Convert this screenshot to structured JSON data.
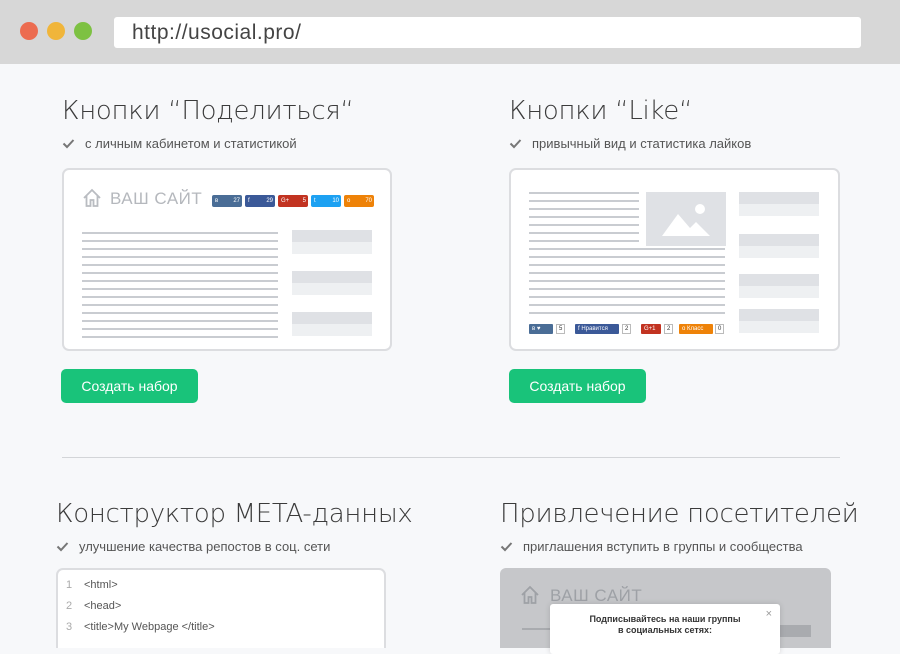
{
  "browser": {
    "url": "http://usocial.pro/"
  },
  "sections": {
    "share": {
      "title": "Кнопки “Поделиться“",
      "subtitle": "с личным кабинетом и статистикой",
      "button": "Создать набор",
      "site_label": "ВАШ САЙТ",
      "counts": [
        "27",
        "29",
        "5",
        "10",
        "70"
      ],
      "network_icons": [
        "vk-icon",
        "facebook-icon",
        "google-plus-icon",
        "twitter-icon",
        "odnoklassniki-icon"
      ],
      "network_colors": [
        "#4a6d96",
        "#3b5998",
        "#c23321",
        "#1da1f2",
        "#ee8208"
      ]
    },
    "like": {
      "title": "Кнопки “Like“",
      "subtitle": "привычный вид и статистика лайков",
      "button": "Создать набор",
      "like_labels": [
        "Нравится",
        "Класс"
      ],
      "like_counts": [
        "5",
        "2",
        "2",
        "0"
      ]
    },
    "meta": {
      "title": "Конструктор META-данных",
      "subtitle": "улучшение качества репостов в соц. сети",
      "code": [
        {
          "ln": "1",
          "text": "<html>"
        },
        {
          "ln": "2",
          "text": "<head>"
        },
        {
          "ln": "3",
          "text": "<title>My Webpage </title>"
        }
      ]
    },
    "visitors": {
      "title": "Привлечение посетителей",
      "subtitle": "приглашения вступить в группы и сообщества",
      "site_label": "ВАШ САЙТ",
      "popup_line1": "Подписывайтесь на наши группы",
      "popup_line2": "в социальных сетях:",
      "close": "×"
    }
  }
}
